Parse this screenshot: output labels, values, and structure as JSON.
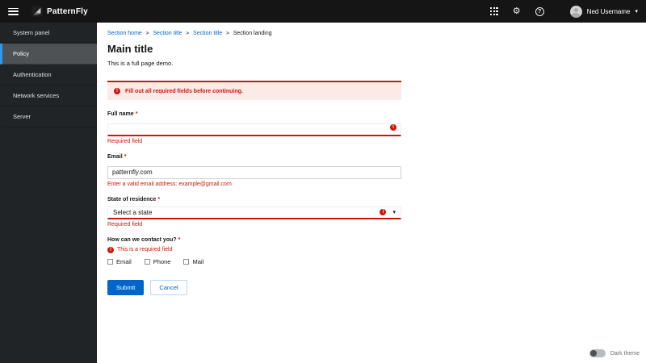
{
  "header": {
    "brand": "PatternFly",
    "user_name": "Ned Username"
  },
  "icons": {
    "exclamation": "!",
    "gear": "⚙",
    "help": "?",
    "caret_down": "▾",
    "breadcrumb_separator": ">"
  },
  "sidebar": {
    "items": [
      {
        "label": "System panel",
        "active": false
      },
      {
        "label": "Policy",
        "active": true
      },
      {
        "label": "Authentication",
        "active": false
      },
      {
        "label": "Network services",
        "active": false
      },
      {
        "label": "Server",
        "active": false
      }
    ]
  },
  "breadcrumb": {
    "items": [
      "Section home",
      "Section title",
      "Section title",
      "Section landing"
    ]
  },
  "page": {
    "title": "Main title",
    "subtitle": "This is a full page demo."
  },
  "alert": {
    "text": "Fill out all required fields before continuing."
  },
  "form": {
    "required_marker": "*",
    "full_name": {
      "label": "Full name",
      "value": "",
      "error": "Required field"
    },
    "email": {
      "label": "Email",
      "value": "patternfly.com",
      "error": "Enter a valid email address: example@gmail.com"
    },
    "state": {
      "label": "State of residence",
      "selected": "Select a state",
      "error": "Required field"
    },
    "contact": {
      "label": "How can we contact you?",
      "error": "This is a required field",
      "options": [
        "Email",
        "Phone",
        "Mail"
      ]
    },
    "submit_label": "Submit",
    "cancel_label": "Cancel"
  },
  "footer": {
    "dark_theme_label": "Dark theme"
  },
  "colors": {
    "danger": "#c9190b",
    "link": "#0066cc",
    "nav_accent": "#2b9af3",
    "masthead_bg": "#151515",
    "sidebar_bg": "#212427",
    "alert_bg": "#faeae8"
  }
}
